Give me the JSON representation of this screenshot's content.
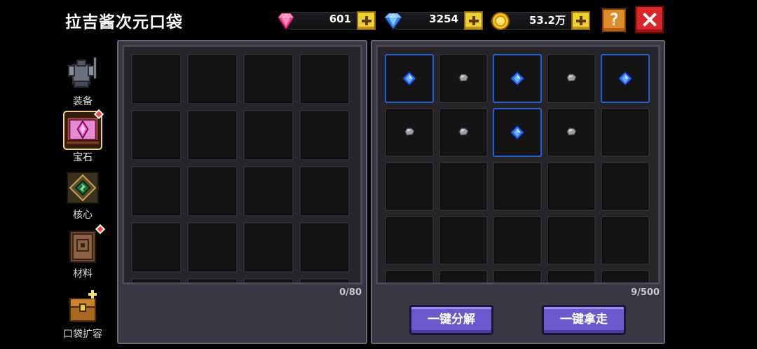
{
  "title": "拉吉酱次元口袋",
  "currencies": [
    {
      "name": "pink-gem",
      "value": "601"
    },
    {
      "name": "blue-diamond",
      "value": "3254"
    },
    {
      "name": "gold-coin",
      "value": "53.2万"
    }
  ],
  "help_label": "?",
  "sidebar": {
    "items": [
      {
        "label": "装备",
        "icon": "equipment-icon",
        "badge": false,
        "active": false
      },
      {
        "label": "宝石",
        "icon": "gem-chest-icon",
        "badge": true,
        "active": true
      },
      {
        "label": "核心",
        "icon": "core-icon",
        "badge": false,
        "active": false
      },
      {
        "label": "材料",
        "icon": "material-book-icon",
        "badge": true,
        "active": false
      },
      {
        "label": "口袋扩容",
        "icon": "treasure-chest-icon",
        "badge": false,
        "active": false
      }
    ]
  },
  "left_panel": {
    "count": "0/80",
    "slots": []
  },
  "right_panel": {
    "count": "9/500",
    "slots": [
      "blue-gem",
      "stone",
      "blue-gem",
      "stone",
      "blue-gem",
      "stone",
      "stone",
      "blue-gem",
      "stone"
    ]
  },
  "buttons": {
    "decompose_all": "一键分解",
    "take_all": "一键拿走"
  },
  "colors": {
    "accent": "#6a5acd",
    "rare_border": "#2460c8",
    "close": "#d8262a",
    "help": "#e08a28"
  }
}
